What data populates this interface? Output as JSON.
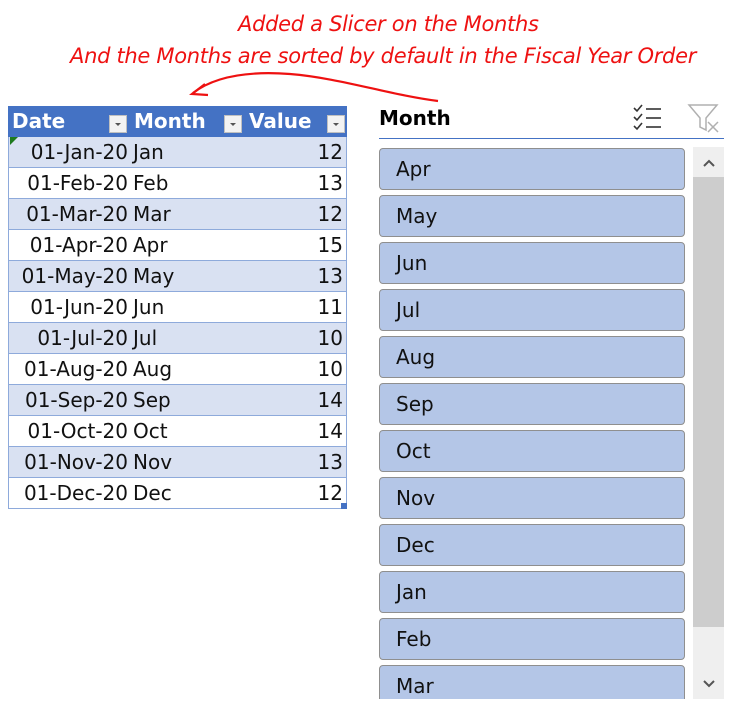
{
  "annotation": {
    "line1": "Added a Slicer on the Months",
    "line2": "And the Months are sorted by default in the Fiscal Year Order",
    "color": "#ee1111"
  },
  "table": {
    "header_color": "#4472c4",
    "band_color": "#d9e1f2",
    "columns": [
      "Date",
      "Month",
      "Value"
    ],
    "rows": [
      {
        "date": "01-Jan-20",
        "month": "Jan",
        "value": "12"
      },
      {
        "date": "01-Feb-20",
        "month": "Feb",
        "value": "13"
      },
      {
        "date": "01-Mar-20",
        "month": "Mar",
        "value": "12"
      },
      {
        "date": "01-Apr-20",
        "month": "Apr",
        "value": "15"
      },
      {
        "date": "01-May-20",
        "month": "May",
        "value": "13"
      },
      {
        "date": "01-Jun-20",
        "month": "Jun",
        "value": "11"
      },
      {
        "date": "01-Jul-20",
        "month": "Jul",
        "value": "10"
      },
      {
        "date": "01-Aug-20",
        "month": "Aug",
        "value": "10"
      },
      {
        "date": "01-Sep-20",
        "month": "Sep",
        "value": "14"
      },
      {
        "date": "01-Oct-20",
        "month": "Oct",
        "value": "14"
      },
      {
        "date": "01-Nov-20",
        "month": "Nov",
        "value": "13"
      },
      {
        "date": "01-Dec-20",
        "month": "Dec",
        "value": "12"
      }
    ]
  },
  "slicer": {
    "title": "Month",
    "icons": {
      "multi_select": "multi-select-icon",
      "clear_filter": "clear-filter-icon"
    },
    "button_color": "#b4c6e7",
    "items": [
      "Apr",
      "May",
      "Jun",
      "Jul",
      "Aug",
      "Sep",
      "Oct",
      "Nov",
      "Dec",
      "Jan",
      "Feb",
      "Mar"
    ]
  }
}
